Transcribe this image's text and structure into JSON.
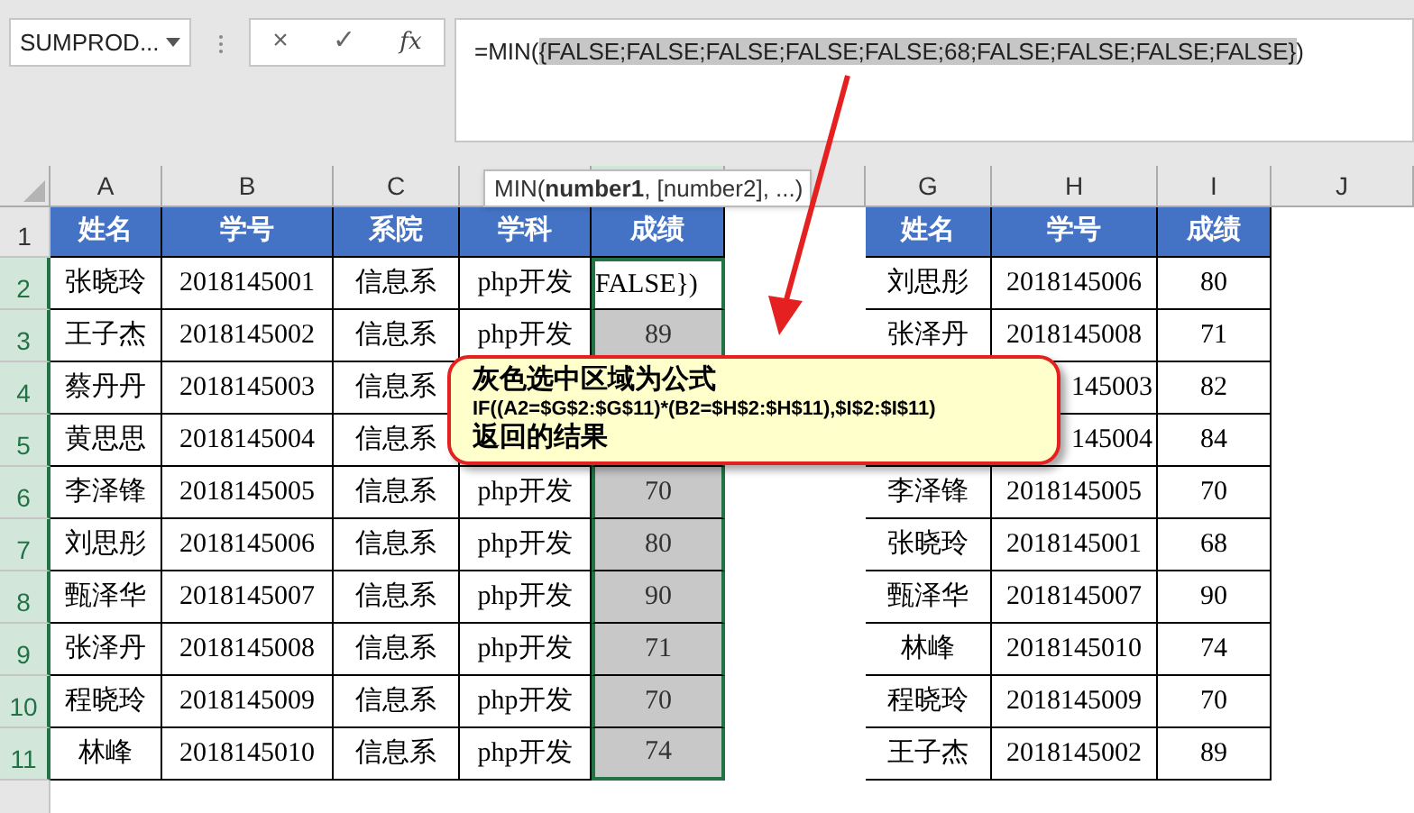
{
  "name_box": {
    "value": "SUMPROD..."
  },
  "formula_bar": {
    "buttons": [
      "×",
      "✓",
      "fx"
    ],
    "prefix": "=MIN(",
    "highlighted": "{FALSE;FALSE;FALSE;FALSE;FALSE;68;FALSE;FALSE;FALSE;FALSE}",
    "suffix": ")"
  },
  "tooltip": "MIN(**number1**, [number2], ...)",
  "columns": [
    {
      "label": "A",
      "selected": false
    },
    {
      "label": "B",
      "selected": false
    },
    {
      "label": "C",
      "selected": false
    },
    {
      "selected": false
    },
    {
      "selected": true
    },
    {
      "selected": false
    },
    {
      "label": "G",
      "selected": false
    },
    {
      "label": "H",
      "selected": false
    },
    {
      "label": "I",
      "selected": false
    },
    {
      "label": "J",
      "selected": false
    }
  ],
  "rows": [
    {
      "label": "1",
      "selected": false,
      "cells": [
        {
          "kind": "header",
          "text": "姓名"
        },
        {
          "kind": "header",
          "text": "学号"
        },
        {
          "kind": "header",
          "text": "系院"
        },
        {
          "kind": "header",
          "text": "学科"
        },
        {
          "kind": "header",
          "text": "成绩"
        },
        null,
        {
          "kind": "header",
          "text": "姓名"
        },
        {
          "kind": "header",
          "text": "学号"
        },
        {
          "kind": "header",
          "text": "成绩"
        },
        null
      ]
    },
    {
      "label": "2",
      "selected": true,
      "cells": [
        {
          "kind": "data",
          "text": "张晓玲"
        },
        {
          "kind": "data",
          "text": "2018145001"
        },
        {
          "kind": "data",
          "text": "信息系"
        },
        {
          "kind": "data",
          "text": "php开发"
        },
        {
          "kind": "editing",
          "text": "FALSE})"
        },
        null,
        {
          "kind": "data",
          "text": "刘思彤"
        },
        {
          "kind": "data",
          "text": "2018145006"
        },
        {
          "kind": "data",
          "text": "80"
        },
        null
      ]
    },
    {
      "label": "3",
      "selected": true,
      "cells": [
        {
          "kind": "data",
          "text": "王子杰"
        },
        {
          "kind": "data",
          "text": "2018145002"
        },
        {
          "kind": "data",
          "text": "信息系"
        },
        {
          "kind": "data",
          "text": "php开发"
        },
        {
          "kind": "result",
          "text": "89"
        },
        null,
        {
          "kind": "data",
          "text": "张泽丹"
        },
        {
          "kind": "data",
          "text": "2018145008"
        },
        {
          "kind": "data",
          "text": "71"
        },
        null
      ]
    },
    {
      "label": "4",
      "selected": true,
      "cells": [
        {
          "kind": "data",
          "text": "蔡丹丹"
        },
        {
          "kind": "data",
          "text": "2018145003"
        },
        {
          "kind": "data",
          "text": "信息系"
        },
        {
          "kind": "data",
          "text": null
        },
        {
          "kind": "result",
          "text": null
        },
        null,
        {
          "kind": "data",
          "text": null
        },
        {
          "kind": "partial",
          "text": "145003"
        },
        {
          "kind": "data",
          "text": "82"
        },
        null
      ]
    },
    {
      "label": "5",
      "selected": true,
      "cells": [
        {
          "kind": "data",
          "text": "黄思思"
        },
        {
          "kind": "data",
          "text": "2018145004"
        },
        {
          "kind": "data",
          "text": "信息系"
        },
        {
          "kind": "data",
          "text": null
        },
        {
          "kind": "result",
          "text": null
        },
        null,
        {
          "kind": "data",
          "text": null
        },
        {
          "kind": "partial",
          "text": "145004"
        },
        {
          "kind": "data",
          "text": "84"
        },
        null
      ]
    },
    {
      "label": "6",
      "selected": true,
      "cells": [
        {
          "kind": "data",
          "text": "李泽锋"
        },
        {
          "kind": "data",
          "text": "2018145005"
        },
        {
          "kind": "data",
          "text": "信息系"
        },
        {
          "kind": "data",
          "text": "php开发"
        },
        {
          "kind": "result",
          "text": "70"
        },
        null,
        {
          "kind": "data",
          "text": "李泽锋"
        },
        {
          "kind": "data",
          "text": "2018145005"
        },
        {
          "kind": "data",
          "text": "70"
        },
        null
      ]
    },
    {
      "label": "7",
      "selected": true,
      "cells": [
        {
          "kind": "data",
          "text": "刘思彤"
        },
        {
          "kind": "data",
          "text": "2018145006"
        },
        {
          "kind": "data",
          "text": "信息系"
        },
        {
          "kind": "data",
          "text": "php开发"
        },
        {
          "kind": "result",
          "text": "80"
        },
        null,
        {
          "kind": "data",
          "text": "张晓玲"
        },
        {
          "kind": "data",
          "text": "2018145001"
        },
        {
          "kind": "data",
          "text": "68"
        },
        null
      ]
    },
    {
      "label": "8",
      "selected": true,
      "cells": [
        {
          "kind": "data",
          "text": "甄泽华"
        },
        {
          "kind": "data",
          "text": "2018145007"
        },
        {
          "kind": "data",
          "text": "信息系"
        },
        {
          "kind": "data",
          "text": "php开发"
        },
        {
          "kind": "result",
          "text": "90"
        },
        null,
        {
          "kind": "data",
          "text": "甄泽华"
        },
        {
          "kind": "data",
          "text": "2018145007"
        },
        {
          "kind": "data",
          "text": "90"
        },
        null
      ]
    },
    {
      "label": "9",
      "selected": true,
      "cells": [
        {
          "kind": "data",
          "text": "张泽丹"
        },
        {
          "kind": "data",
          "text": "2018145008"
        },
        {
          "kind": "data",
          "text": "信息系"
        },
        {
          "kind": "data",
          "text": "php开发"
        },
        {
          "kind": "result",
          "text": "71"
        },
        null,
        {
          "kind": "data",
          "text": "林峰"
        },
        {
          "kind": "data",
          "text": "2018145010"
        },
        {
          "kind": "data",
          "text": "74"
        },
        null
      ]
    },
    {
      "label": "10",
      "selected": true,
      "cells": [
        {
          "kind": "data",
          "text": "程晓玲"
        },
        {
          "kind": "data",
          "text": "2018145009"
        },
        {
          "kind": "data",
          "text": "信息系"
        },
        {
          "kind": "data",
          "text": "php开发"
        },
        {
          "kind": "result",
          "text": "70"
        },
        null,
        {
          "kind": "data",
          "text": "程晓玲"
        },
        {
          "kind": "data",
          "text": "2018145009"
        },
        {
          "kind": "data",
          "text": "70"
        },
        null
      ]
    },
    {
      "label": "11",
      "selected": true,
      "cells": [
        {
          "kind": "data",
          "text": "林峰"
        },
        {
          "kind": "data",
          "text": "2018145010"
        },
        {
          "kind": "data",
          "text": "信息系"
        },
        {
          "kind": "data",
          "text": "php开发"
        },
        {
          "kind": "result",
          "text": "74"
        },
        null,
        {
          "kind": "data",
          "text": "王子杰"
        },
        {
          "kind": "data",
          "text": "2018145002"
        },
        {
          "kind": "data",
          "text": "89"
        },
        null
      ]
    }
  ],
  "callout": {
    "title": "灰色选中区域为公式",
    "formula": "IF((A2=$G$2:$G$11)*(B2=$H$2:$H$11),$I$2:$I$11)",
    "footer": "返回的结果"
  }
}
